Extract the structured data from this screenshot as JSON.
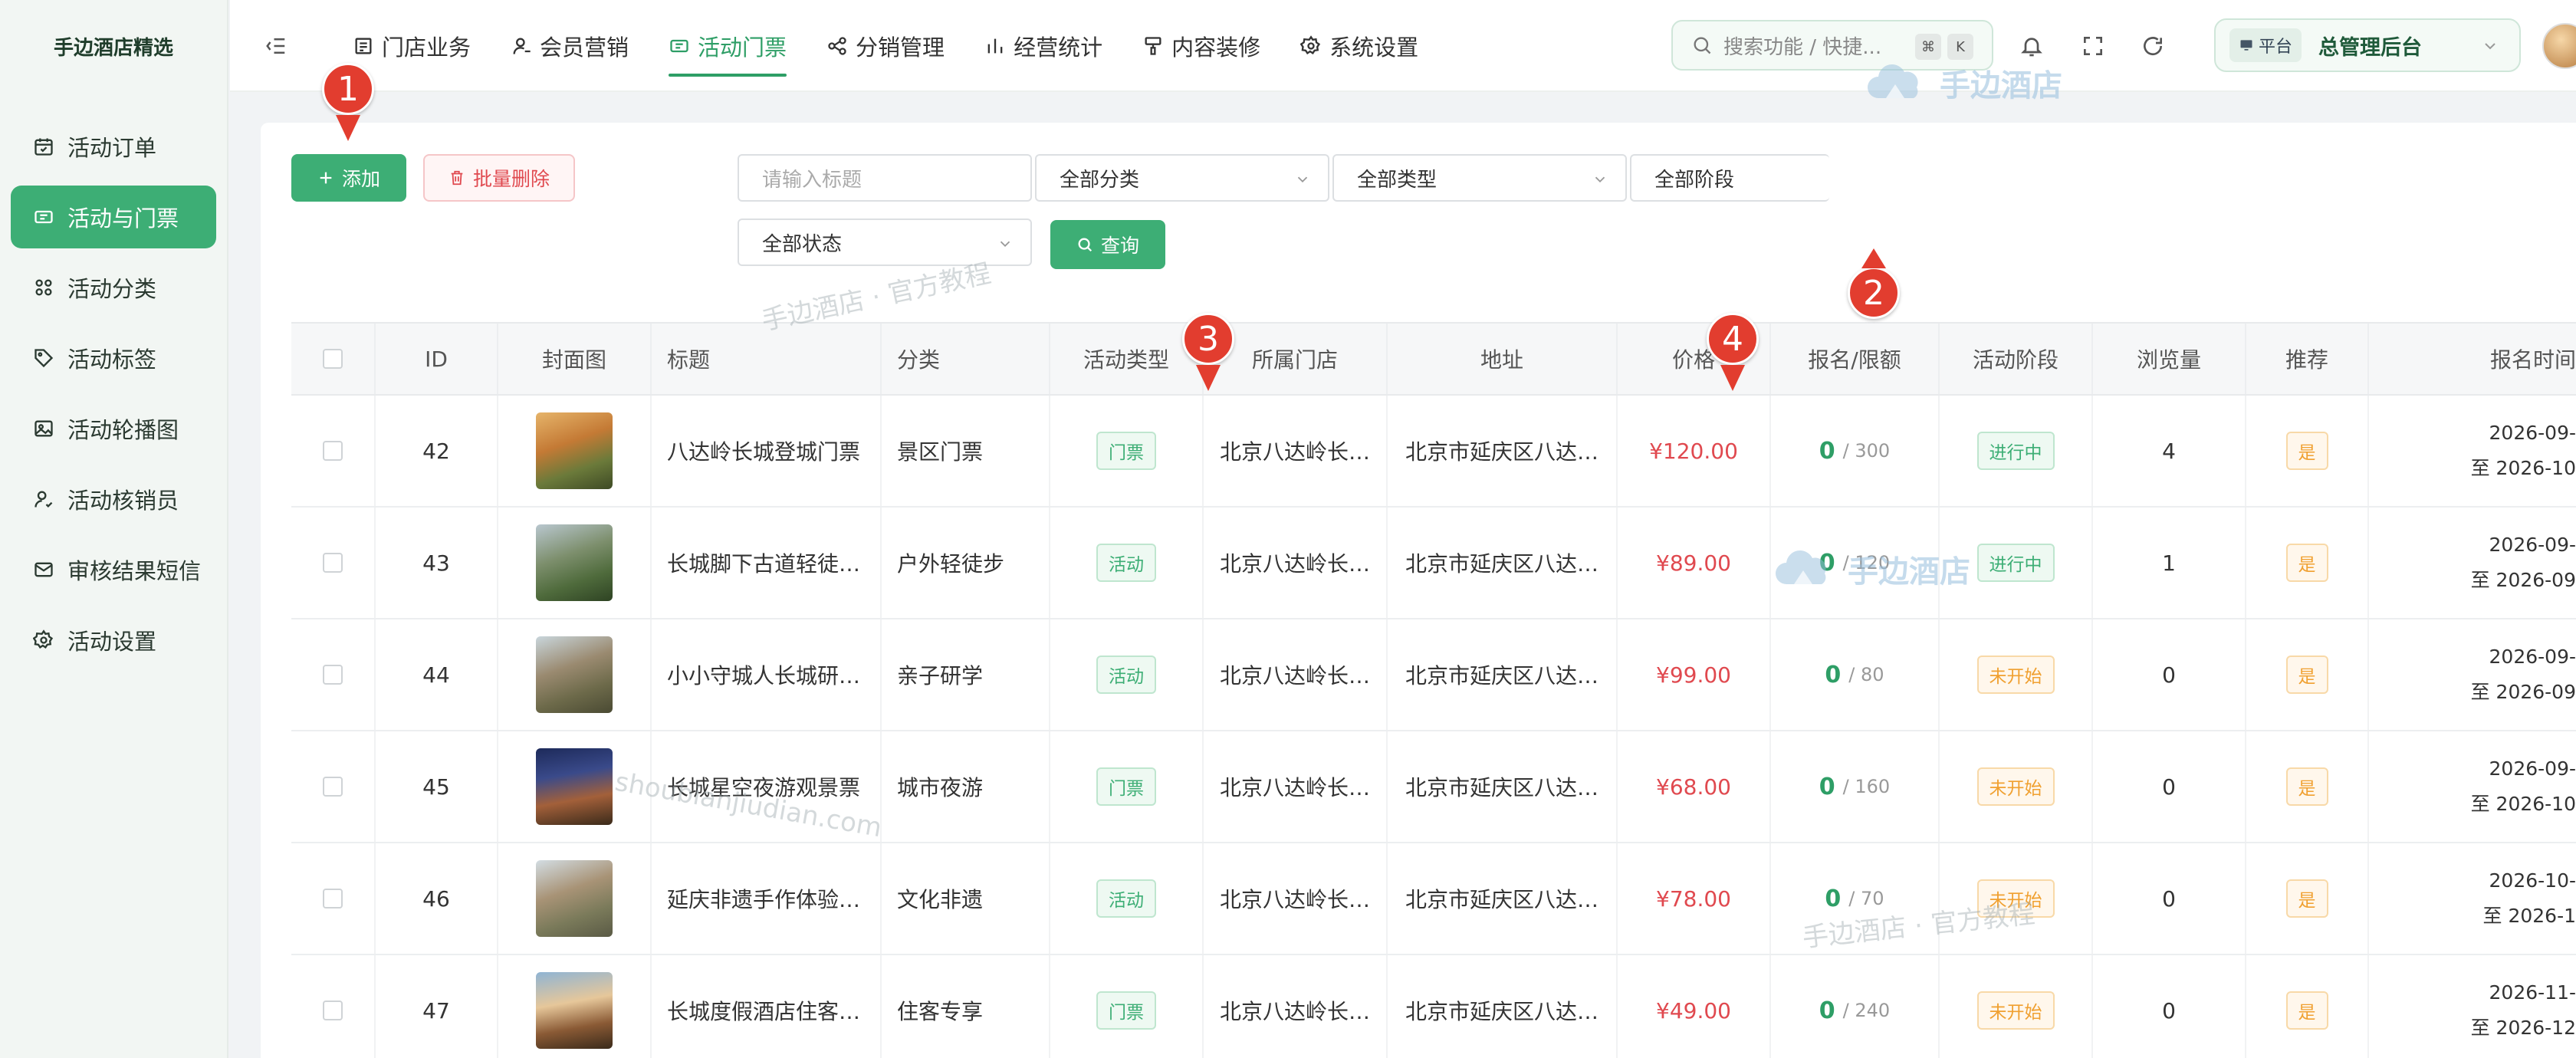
{
  "brand": "手边酒店精选",
  "sidebar": {
    "items": [
      {
        "label": "活动订单",
        "icon": "calendar-check-icon",
        "active": false
      },
      {
        "label": "活动与门票",
        "icon": "ticket-icon",
        "active": true
      },
      {
        "label": "活动分类",
        "icon": "grid-icon",
        "active": false
      },
      {
        "label": "活动标签",
        "icon": "tag-icon",
        "active": false
      },
      {
        "label": "活动轮播图",
        "icon": "image-icon",
        "active": false
      },
      {
        "label": "活动核销员",
        "icon": "user-check-icon",
        "active": false
      },
      {
        "label": "审核结果短信",
        "icon": "mail-icon",
        "active": false
      },
      {
        "label": "活动设置",
        "icon": "gear-icon",
        "active": false
      }
    ]
  },
  "topnav": {
    "items": [
      {
        "label": "门店业务",
        "icon": "store-icon",
        "active": false
      },
      {
        "label": "会员营销",
        "icon": "user-icon",
        "active": false
      },
      {
        "label": "活动门票",
        "icon": "ticket-icon",
        "active": true
      },
      {
        "label": "分销管理",
        "icon": "share-icon",
        "active": false
      },
      {
        "label": "经营统计",
        "icon": "bar-chart-icon",
        "active": false
      },
      {
        "label": "内容装修",
        "icon": "brush-icon",
        "active": false
      },
      {
        "label": "系统设置",
        "icon": "gear-icon",
        "active": false
      }
    ],
    "search_placeholder": "搜索功能 / 快捷...",
    "kbd_cmd": "⌘",
    "kbd_k": "K",
    "platform_tag": "平台",
    "platform_name": "总管理后台"
  },
  "toolbar": {
    "add_label": "添加",
    "batch_delete_label": "批量删除",
    "query_label": "查询"
  },
  "filters": {
    "title_placeholder": "请输入标题",
    "category": "全部分类",
    "type": "全部类型",
    "stage": "全部阶段",
    "status": "全部状态"
  },
  "table": {
    "columns": [
      "ID",
      "封面图",
      "标题",
      "分类",
      "活动类型",
      "所属门店",
      "地址",
      "价格",
      "报名/限额",
      "活动阶段",
      "浏览量",
      "推荐",
      "报名时间"
    ],
    "rows": [
      {
        "id": "42",
        "title": "八达岭长城登城门票",
        "category": "景区门票",
        "type": "门票",
        "store": "北京八达岭长…",
        "address": "北京市延庆区八达…",
        "price": "¥120.00",
        "enrolled": "0",
        "limit": "/ 300",
        "stage": "进行中",
        "stage_color": "green",
        "views": "4",
        "recommend": "是",
        "date_start": "2026-09-",
        "date_end": "至 2026-10"
      },
      {
        "id": "43",
        "title": "长城脚下古道轻徒…",
        "category": "户外轻徒步",
        "type": "活动",
        "store": "北京八达岭长…",
        "address": "北京市延庆区八达…",
        "price": "¥89.00",
        "enrolled": "0",
        "limit": "/ 120",
        "stage": "进行中",
        "stage_color": "green",
        "views": "1",
        "recommend": "是",
        "date_start": "2026-09-",
        "date_end": "至 2026-09"
      },
      {
        "id": "44",
        "title": "小小守城人长城研…",
        "category": "亲子研学",
        "type": "活动",
        "store": "北京八达岭长…",
        "address": "北京市延庆区八达…",
        "price": "¥99.00",
        "enrolled": "0",
        "limit": "/ 80",
        "stage": "未开始",
        "stage_color": "orange",
        "views": "0",
        "recommend": "是",
        "date_start": "2026-09-",
        "date_end": "至 2026-09"
      },
      {
        "id": "45",
        "title": "长城星空夜游观景票",
        "category": "城市夜游",
        "type": "门票",
        "store": "北京八达岭长…",
        "address": "北京市延庆区八达…",
        "price": "¥68.00",
        "enrolled": "0",
        "limit": "/ 160",
        "stage": "未开始",
        "stage_color": "orange",
        "views": "0",
        "recommend": "是",
        "date_start": "2026-09-",
        "date_end": "至 2026-10"
      },
      {
        "id": "46",
        "title": "延庆非遗手作体验…",
        "category": "文化非遗",
        "type": "活动",
        "store": "北京八达岭长…",
        "address": "北京市延庆区八达…",
        "price": "¥78.00",
        "enrolled": "0",
        "limit": "/ 70",
        "stage": "未开始",
        "stage_color": "orange",
        "views": "0",
        "recommend": "是",
        "date_start": "2026-10-",
        "date_end": "至 2026-1"
      },
      {
        "id": "47",
        "title": "长城度假酒店住客…",
        "category": "住客专享",
        "type": "门票",
        "store": "北京八达岭长…",
        "address": "北京市延庆区八达…",
        "price": "¥49.00",
        "enrolled": "0",
        "limit": "/ 240",
        "stage": "未开始",
        "stage_color": "orange",
        "views": "0",
        "recommend": "是",
        "date_start": "2026-11-",
        "date_end": "至 2026-12"
      }
    ]
  },
  "annotations": [
    "1",
    "2",
    "3",
    "4"
  ],
  "watermarks": {
    "logo_text": "手边酒店",
    "tutorial_text": "手边酒店 · 官方教程",
    "domain_text": "shoubianjiudian.com"
  },
  "colors": {
    "accent": "#3dae75",
    "danger": "#e0494f",
    "warning": "#f0a030",
    "badge": "#e23d2f"
  }
}
